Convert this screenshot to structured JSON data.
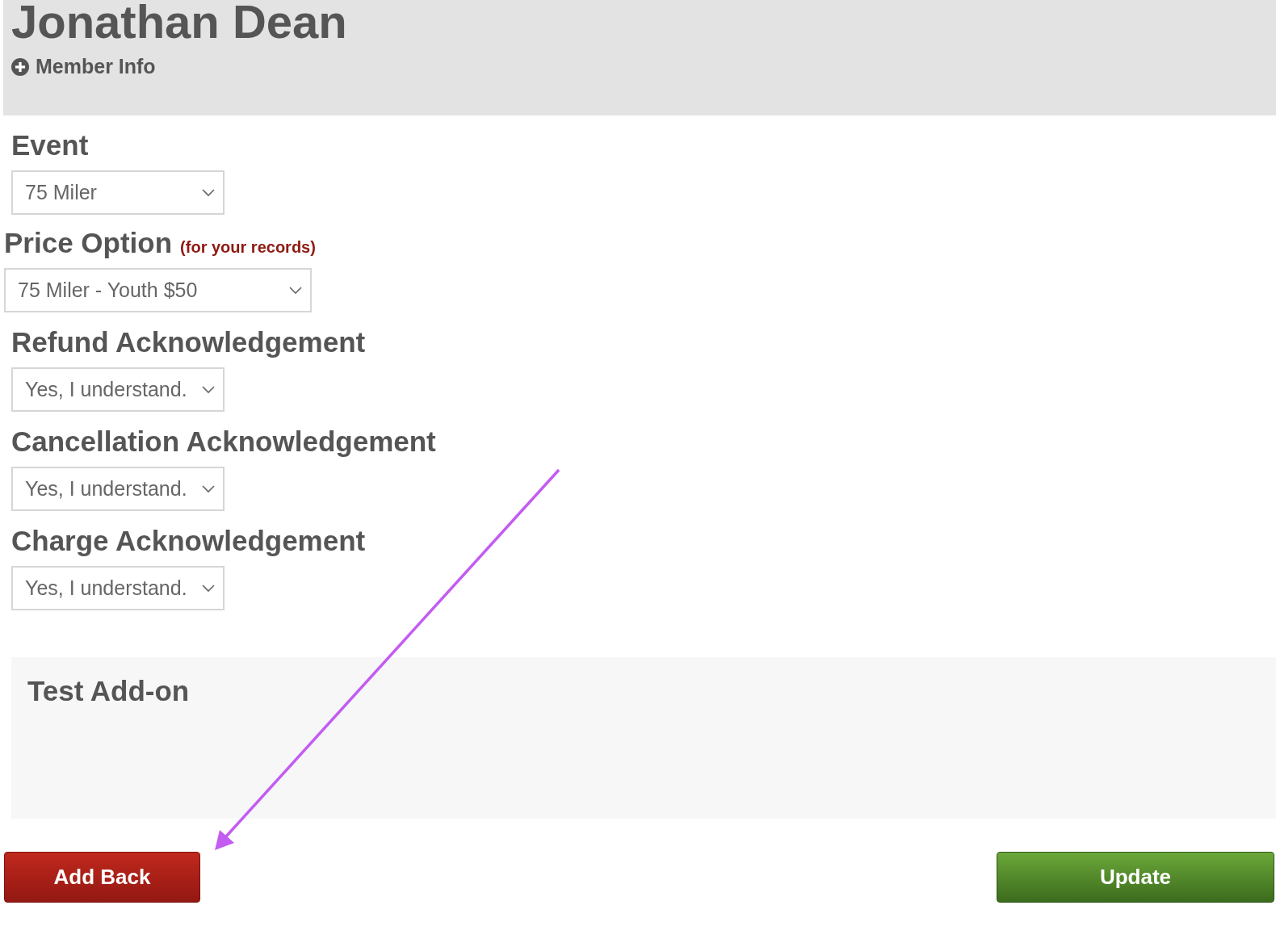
{
  "header": {
    "name": "Jonathan Dean",
    "toggle": {
      "label": "Member Info",
      "expanded": false
    }
  },
  "fields": [
    {
      "label": "Event",
      "value": "75 Miler"
    },
    {
      "label": "Price Option",
      "note": "(for your records)",
      "value": "75 Miler - Youth $50"
    },
    {
      "label": "Refund Acknowledgement",
      "value": "Yes, I understand."
    },
    {
      "label": "Cancellation Acknowledgement",
      "value": "Yes, I understand."
    },
    {
      "label": "Charge Acknowledgement",
      "value": "Yes, I understand."
    }
  ],
  "addon": {
    "title": "Test Add-on"
  },
  "buttons": [
    {
      "label": "Add Back",
      "kind": "danger"
    },
    {
      "label": "Update",
      "kind": "primary"
    }
  ]
}
